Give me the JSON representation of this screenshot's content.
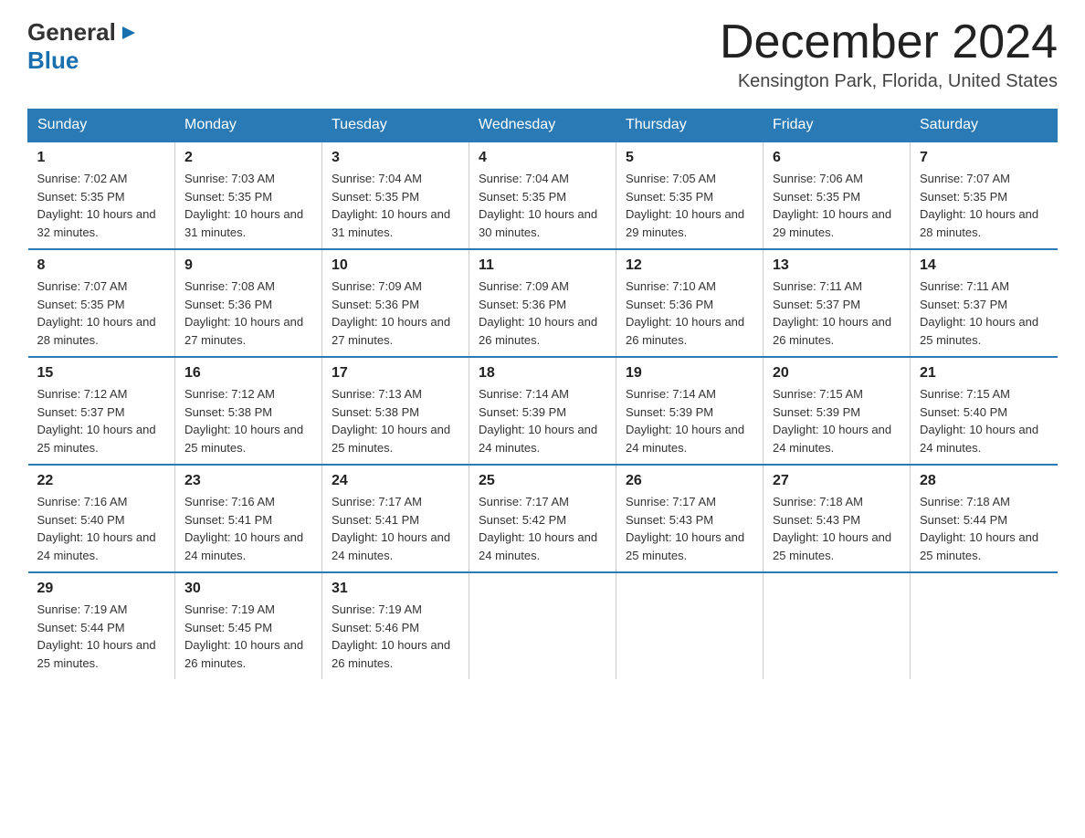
{
  "header": {
    "logo_general": "General",
    "logo_blue": "Blue",
    "month_title": "December 2024",
    "location": "Kensington Park, Florida, United States"
  },
  "days_of_week": [
    "Sunday",
    "Monday",
    "Tuesday",
    "Wednesday",
    "Thursday",
    "Friday",
    "Saturday"
  ],
  "weeks": [
    [
      {
        "day": "1",
        "sunrise": "7:02 AM",
        "sunset": "5:35 PM",
        "daylight": "10 hours and 32 minutes."
      },
      {
        "day": "2",
        "sunrise": "7:03 AM",
        "sunset": "5:35 PM",
        "daylight": "10 hours and 31 minutes."
      },
      {
        "day": "3",
        "sunrise": "7:04 AM",
        "sunset": "5:35 PM",
        "daylight": "10 hours and 31 minutes."
      },
      {
        "day": "4",
        "sunrise": "7:04 AM",
        "sunset": "5:35 PM",
        "daylight": "10 hours and 30 minutes."
      },
      {
        "day": "5",
        "sunrise": "7:05 AM",
        "sunset": "5:35 PM",
        "daylight": "10 hours and 29 minutes."
      },
      {
        "day": "6",
        "sunrise": "7:06 AM",
        "sunset": "5:35 PM",
        "daylight": "10 hours and 29 minutes."
      },
      {
        "day": "7",
        "sunrise": "7:07 AM",
        "sunset": "5:35 PM",
        "daylight": "10 hours and 28 minutes."
      }
    ],
    [
      {
        "day": "8",
        "sunrise": "7:07 AM",
        "sunset": "5:35 PM",
        "daylight": "10 hours and 28 minutes."
      },
      {
        "day": "9",
        "sunrise": "7:08 AM",
        "sunset": "5:36 PM",
        "daylight": "10 hours and 27 minutes."
      },
      {
        "day": "10",
        "sunrise": "7:09 AM",
        "sunset": "5:36 PM",
        "daylight": "10 hours and 27 minutes."
      },
      {
        "day": "11",
        "sunrise": "7:09 AM",
        "sunset": "5:36 PM",
        "daylight": "10 hours and 26 minutes."
      },
      {
        "day": "12",
        "sunrise": "7:10 AM",
        "sunset": "5:36 PM",
        "daylight": "10 hours and 26 minutes."
      },
      {
        "day": "13",
        "sunrise": "7:11 AM",
        "sunset": "5:37 PM",
        "daylight": "10 hours and 26 minutes."
      },
      {
        "day": "14",
        "sunrise": "7:11 AM",
        "sunset": "5:37 PM",
        "daylight": "10 hours and 25 minutes."
      }
    ],
    [
      {
        "day": "15",
        "sunrise": "7:12 AM",
        "sunset": "5:37 PM",
        "daylight": "10 hours and 25 minutes."
      },
      {
        "day": "16",
        "sunrise": "7:12 AM",
        "sunset": "5:38 PM",
        "daylight": "10 hours and 25 minutes."
      },
      {
        "day": "17",
        "sunrise": "7:13 AM",
        "sunset": "5:38 PM",
        "daylight": "10 hours and 25 minutes."
      },
      {
        "day": "18",
        "sunrise": "7:14 AM",
        "sunset": "5:39 PM",
        "daylight": "10 hours and 24 minutes."
      },
      {
        "day": "19",
        "sunrise": "7:14 AM",
        "sunset": "5:39 PM",
        "daylight": "10 hours and 24 minutes."
      },
      {
        "day": "20",
        "sunrise": "7:15 AM",
        "sunset": "5:39 PM",
        "daylight": "10 hours and 24 minutes."
      },
      {
        "day": "21",
        "sunrise": "7:15 AM",
        "sunset": "5:40 PM",
        "daylight": "10 hours and 24 minutes."
      }
    ],
    [
      {
        "day": "22",
        "sunrise": "7:16 AM",
        "sunset": "5:40 PM",
        "daylight": "10 hours and 24 minutes."
      },
      {
        "day": "23",
        "sunrise": "7:16 AM",
        "sunset": "5:41 PM",
        "daylight": "10 hours and 24 minutes."
      },
      {
        "day": "24",
        "sunrise": "7:17 AM",
        "sunset": "5:41 PM",
        "daylight": "10 hours and 24 minutes."
      },
      {
        "day": "25",
        "sunrise": "7:17 AM",
        "sunset": "5:42 PM",
        "daylight": "10 hours and 24 minutes."
      },
      {
        "day": "26",
        "sunrise": "7:17 AM",
        "sunset": "5:43 PM",
        "daylight": "10 hours and 25 minutes."
      },
      {
        "day": "27",
        "sunrise": "7:18 AM",
        "sunset": "5:43 PM",
        "daylight": "10 hours and 25 minutes."
      },
      {
        "day": "28",
        "sunrise": "7:18 AM",
        "sunset": "5:44 PM",
        "daylight": "10 hours and 25 minutes."
      }
    ],
    [
      {
        "day": "29",
        "sunrise": "7:19 AM",
        "sunset": "5:44 PM",
        "daylight": "10 hours and 25 minutes."
      },
      {
        "day": "30",
        "sunrise": "7:19 AM",
        "sunset": "5:45 PM",
        "daylight": "10 hours and 26 minutes."
      },
      {
        "day": "31",
        "sunrise": "7:19 AM",
        "sunset": "5:46 PM",
        "daylight": "10 hours and 26 minutes."
      },
      null,
      null,
      null,
      null
    ]
  ],
  "labels": {
    "sunrise_prefix": "Sunrise: ",
    "sunset_prefix": "Sunset: ",
    "daylight_prefix": "Daylight: "
  }
}
